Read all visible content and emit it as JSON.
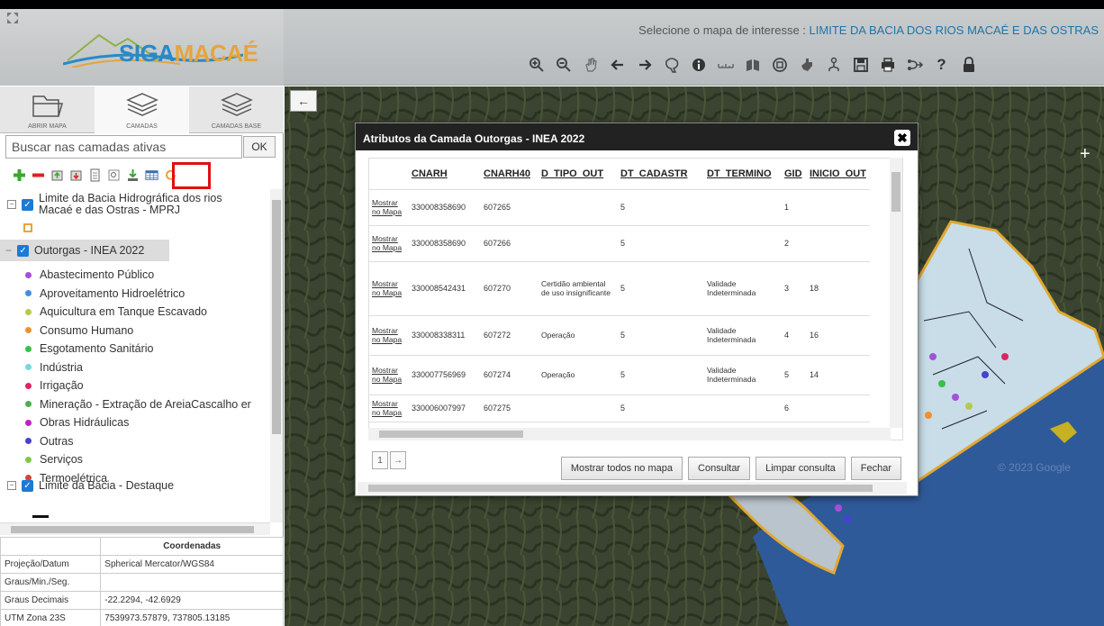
{
  "header": {
    "logo_prefix": "SIGA",
    "logo_suffix": "MACAÉ",
    "map_select_label": "Selecione o mapa de interesse :",
    "map_select_value": "LIMITE DA BACIA DOS RIOS MACAÉ E DAS OSTRAS"
  },
  "toolbar": [
    "zoom-in-icon",
    "zoom-out-icon",
    "pan-icon",
    "back-arrow-icon",
    "forward-arrow-icon",
    "select-icon",
    "info-icon",
    "measure-icon",
    "layers-icon",
    "capture-icon",
    "hand-icon",
    "share-icon",
    "save-icon",
    "print-icon",
    "route-icon",
    "help-icon",
    "lock-icon"
  ],
  "sidebar": {
    "tabs": [
      "ABRIR MAPA",
      "CAMADAS",
      "CAMADAS BASE"
    ],
    "search_placeholder": "Buscar nas camadas ativas",
    "ok_label": "OK",
    "tree": {
      "layer1": "Limite da Bacia Hidrográfica dos rios",
      "layer1_line2": "Macaé e das Ostras - MPRJ",
      "layer2": "Outorgas - INEA 2022",
      "categories": [
        {
          "label": "Abastecimento Público",
          "color": "#a64fd8"
        },
        {
          "label": "Aproveitamento Hidroelétrico",
          "color": "#3f8fe0"
        },
        {
          "label": "Aquicultura em Tanque Escavado",
          "color": "#b7c94a"
        },
        {
          "label": "Consumo Humano",
          "color": "#f0922c"
        },
        {
          "label": "Esgotamento Sanitário",
          "color": "#36c24a"
        },
        {
          "label": "Indústria",
          "color": "#74d9de"
        },
        {
          "label": "Irrigação",
          "color": "#e0245e"
        },
        {
          "label": "Mineração - Extração de AreiaCascalho er",
          "color": "#4caf50"
        },
        {
          "label": "Obras Hidráulicas",
          "color": "#c21fc2"
        },
        {
          "label": "Outras",
          "color": "#4b3ed4"
        },
        {
          "label": "Serviços",
          "color": "#7ec84a"
        },
        {
          "label": "Termoelétrica",
          "color": "#d6453a"
        }
      ],
      "layer3": "Limite da Bacia - Destaque"
    },
    "coords": {
      "title": "Coordenadas",
      "rows": [
        {
          "label": "Projeção/Datum",
          "value": "Spherical Mercator/WGS84"
        },
        {
          "label": "Graus/Min./Seg.",
          "value": ""
        },
        {
          "label": "Graus Decimais",
          "value": "-22.2294, -42.6929"
        },
        {
          "label": "UTM Zona 23S",
          "value": "7539973.57879, 737805.13185"
        }
      ]
    }
  },
  "map": {
    "back_label": "←",
    "attribution": "© 2023 Google"
  },
  "dialog": {
    "title": "Atributos da Camada Outorgas - INEA 2022",
    "close_label": "✖",
    "columns": [
      "",
      "CNARH",
      "CNARH40",
      "D_TIPO_OUT",
      "DT_CADASTR",
      "DT_TERMINO",
      "GID",
      "INICIO_OUT"
    ],
    "link_label": "Mostrar no Mapa",
    "rows": [
      {
        "cnarh": "330008358690",
        "cnarh40": "607265",
        "tipo": "",
        "cadastr": "5",
        "termino": "",
        "gid": "1",
        "inicio": ""
      },
      {
        "cnarh": "330008358690",
        "cnarh40": "607266",
        "tipo": "",
        "cadastr": "5",
        "termino": "",
        "gid": "2",
        "inicio": ""
      },
      {
        "cnarh": "330008542431",
        "cnarh40": "607270",
        "tipo": "Certidão ambiental de uso insignificante",
        "cadastr": "5",
        "termino": "Validade Indeterminada",
        "gid": "3",
        "inicio": "18"
      },
      {
        "cnarh": "330008338311",
        "cnarh40": "607272",
        "tipo": "Operação",
        "cadastr": "5",
        "termino": "Validade Indeterminada",
        "gid": "4",
        "inicio": "16"
      },
      {
        "cnarh": "330007756969",
        "cnarh40": "607274",
        "tipo": "Operação",
        "cadastr": "5",
        "termino": "Validade Indeterminada",
        "gid": "5",
        "inicio": "14"
      },
      {
        "cnarh": "330006007997",
        "cnarh40": "607275",
        "tipo": "",
        "cadastr": "5",
        "termino": "",
        "gid": "6",
        "inicio": ""
      }
    ],
    "pager": [
      "1",
      "→"
    ],
    "buttons": {
      "show_all": "Mostrar todos no mapa",
      "query": "Consultar",
      "clear": "Limpar consulta",
      "close": "Fechar"
    }
  }
}
